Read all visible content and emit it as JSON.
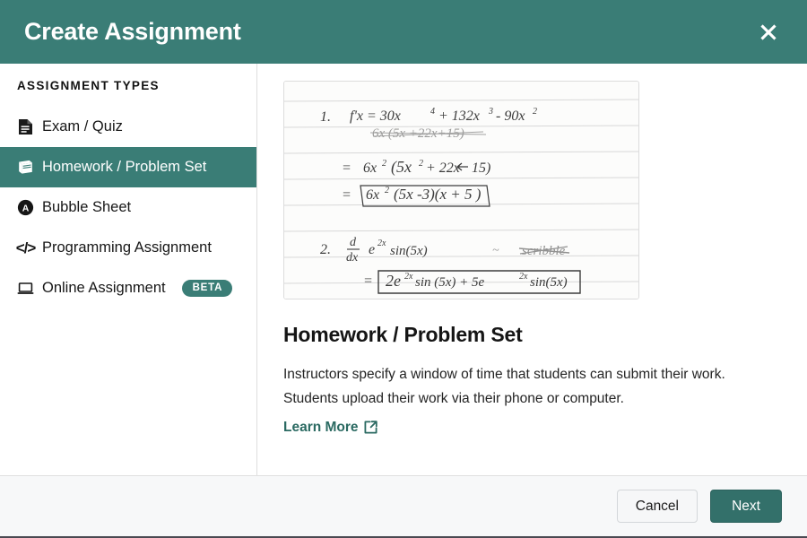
{
  "header": {
    "title": "Create Assignment",
    "close_icon": "close-x-icon",
    "background_color": "#3a7d76"
  },
  "sidebar": {
    "heading": "ASSIGNMENT TYPES",
    "items": [
      {
        "label": "Exam / Quiz",
        "icon": "document-icon",
        "active": false,
        "badge": null
      },
      {
        "label": "Homework / Problem Set",
        "icon": "book-icon",
        "active": true,
        "badge": null
      },
      {
        "label": "Bubble Sheet",
        "icon": "circled-a-icon",
        "active": false,
        "badge": null
      },
      {
        "label": "Programming Assignment",
        "icon": "code-brackets-icon",
        "active": false,
        "badge": null
      },
      {
        "label": "Online Assignment",
        "icon": "laptop-icon",
        "active": false,
        "badge": "BETA"
      }
    ]
  },
  "content": {
    "preview": {
      "alt": "handwritten-calculus-worksheet-preview",
      "lines": [
        "1.   f'x  =  30x⁴ + 132x³ - 90x²",
        "6x²(5x²+22x+15)",
        "=  6x² (5x² + 22x - 15)",
        "=  6x² (5x -3)(x + 5)",
        "2.  d/dx  e²ˣ sin(5x)",
        "=  2e²ˣ sin(5x) + 5e²ˣ sin(5x)"
      ]
    },
    "title": "Homework / Problem Set",
    "description": "Instructors specify a window of time that students can submit their work. Students upload their work via their phone or computer.",
    "learn_more": {
      "label": "Learn More",
      "icon": "external-link-icon"
    }
  },
  "footer": {
    "cancel_label": "Cancel",
    "next_label": "Next"
  },
  "colors": {
    "accent_teal": "#3a7d76",
    "button_teal": "#33706a",
    "link_teal": "#2b6a62"
  }
}
